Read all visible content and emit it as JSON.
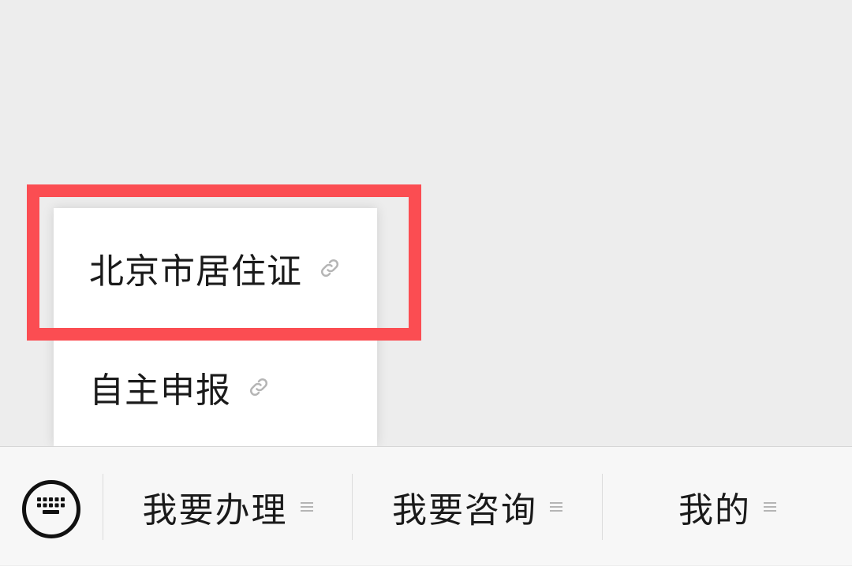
{
  "popup_menu": {
    "items": [
      {
        "label": "北京市居住证",
        "icon": "link-icon"
      },
      {
        "label": "自主申报",
        "icon": "link-icon"
      }
    ]
  },
  "bottom_bar": {
    "keyboard_icon": "keyboard-icon",
    "tabs": [
      {
        "label": "我要办理",
        "icon": "menu-lines-icon"
      },
      {
        "label": "我要咨询",
        "icon": "menu-lines-icon"
      },
      {
        "label": "我的",
        "icon": "menu-lines-icon"
      }
    ]
  },
  "colors": {
    "background": "#ededed",
    "highlight": "#fb4d52",
    "bar_background": "#f7f7f7",
    "text": "#1a1a1a",
    "icon_gray": "#b5b5b5"
  }
}
